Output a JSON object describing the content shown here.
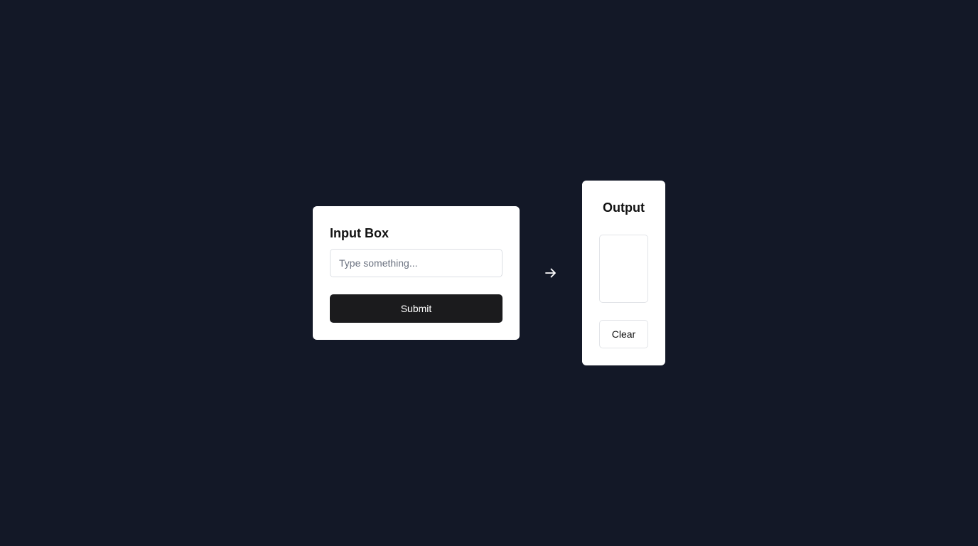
{
  "colors": {
    "background": "#131827",
    "card": "#ffffff",
    "primary_button": "#1b1b1d",
    "border": "#dcdfe4",
    "placeholder": "#6b7280"
  },
  "input_card": {
    "title": "Input Box",
    "input_value": "",
    "input_placeholder": "Type something...",
    "submit_label": "Submit"
  },
  "connector": {
    "icon": "arrow-right-icon"
  },
  "output_card": {
    "title": "Output",
    "output_value": "",
    "clear_label": "Clear"
  }
}
